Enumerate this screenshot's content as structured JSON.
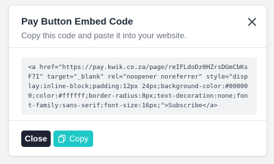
{
  "modal": {
    "title": "Pay Button Embed Code",
    "subtitle": "Copy this code and paste it into your website.",
    "close_icon": "close-icon"
  },
  "code": {
    "snippet": "<a href=\"https://pay.kwik.co.za/page/reIFLdoDz0HZrsDGmCbKsF7I\" target=\"_blank\" rel=\"noopener noreferrer\" style=\"display:inline-block;padding:12px 24px;background-color:#000000;color:#ffffff;border-radius:8px;text-decoration:none;font-family:sans-serif;font-size:16px;\">Subscribe</a>"
  },
  "footer": {
    "close_label": "Close",
    "copy_label": "Copy",
    "copy_icon": "copy-icon"
  },
  "colors": {
    "close_button_bg": "#1e2233",
    "copy_button_bg": "#1ec8c6",
    "code_bg": "#f1f2f4"
  }
}
